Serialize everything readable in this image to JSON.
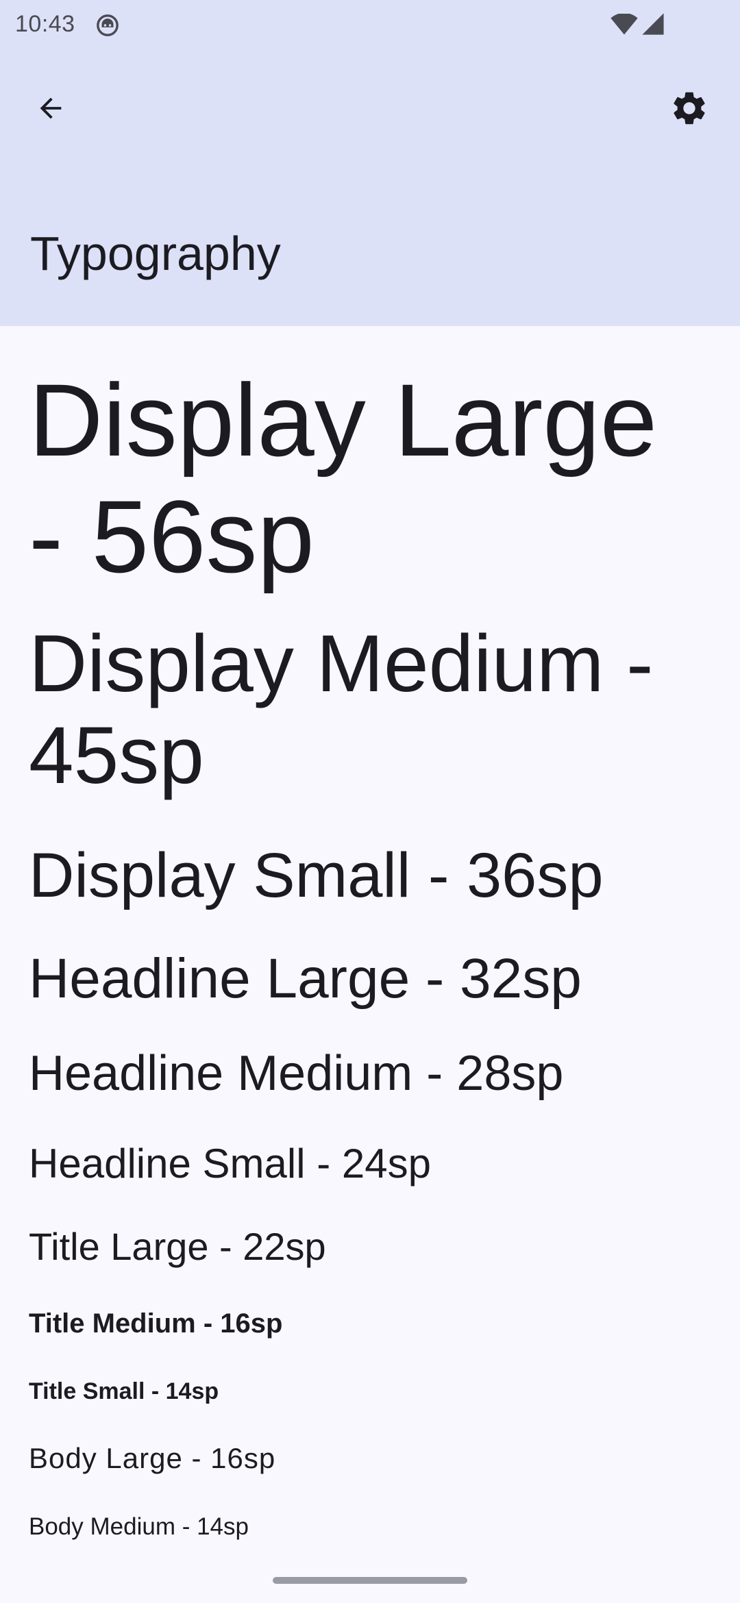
{
  "status_bar": {
    "time": "10:43",
    "icons": [
      "android-robot-icon",
      "wifi-icon",
      "cell-signal-icon"
    ]
  },
  "top_app_bar": {
    "title": "Typography",
    "back_icon": "arrow-back-icon",
    "settings_icon": "gear-icon",
    "background_color": "#dce1f8"
  },
  "typography_samples": [
    {
      "style": "display_large",
      "label": "Display Large - 56sp"
    },
    {
      "style": "display_medium",
      "label": "Display Medium - 45sp"
    },
    {
      "style": "display_small",
      "label": "Display Small - 36sp"
    },
    {
      "style": "headline_large",
      "label": "Headline Large - 32sp"
    },
    {
      "style": "headline_medium",
      "label": "Headline Medium - 28sp"
    },
    {
      "style": "headline_small",
      "label": "Headline Small - 24sp"
    },
    {
      "style": "title_large",
      "label": "Title Large - 22sp"
    },
    {
      "style": "title_medium",
      "label": "Title Medium - 16sp"
    },
    {
      "style": "title_small",
      "label": "Title Small - 14sp"
    },
    {
      "style": "body_large",
      "label": "Body Large - 16sp"
    },
    {
      "style": "body_medium",
      "label": "Body Medium - 14sp"
    }
  ],
  "colors": {
    "background": "#f8f8fe",
    "text": "#1b1b21"
  }
}
